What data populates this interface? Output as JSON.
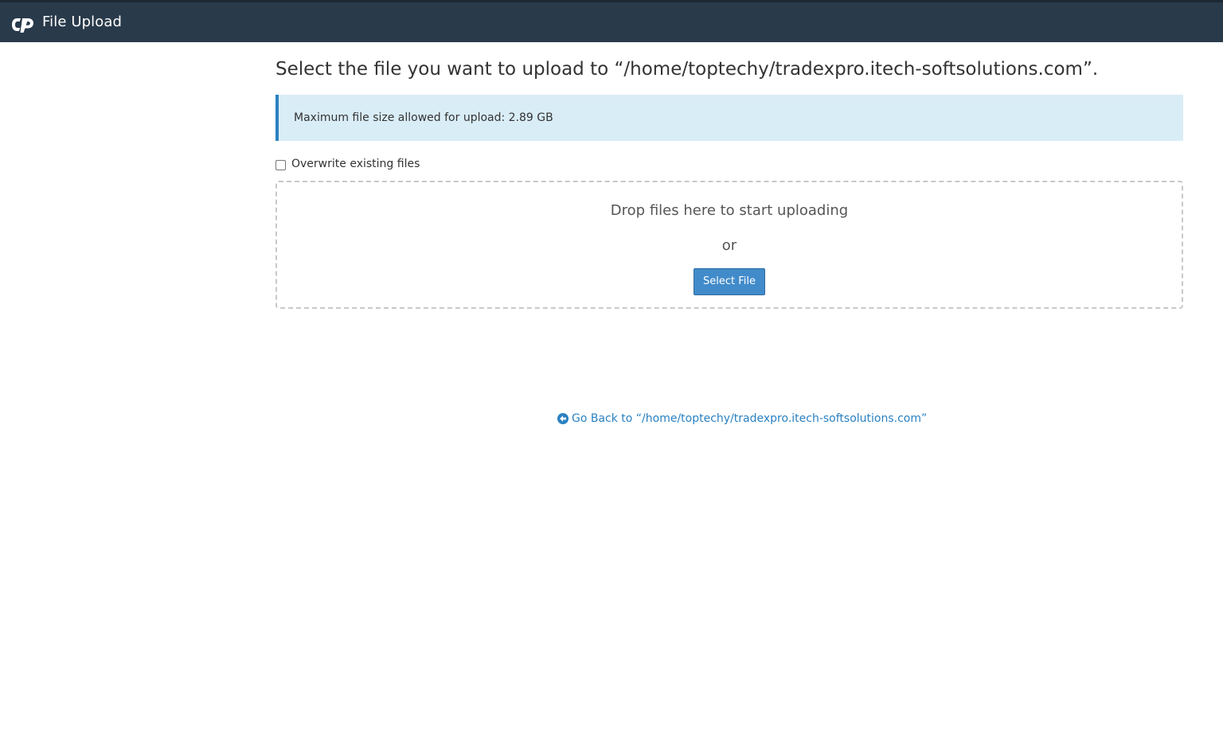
{
  "header": {
    "logo_icon": "cpanel-logo-icon",
    "title": "File Upload",
    "background_color": "#293a4a"
  },
  "main": {
    "heading": "Select the file you want to upload to “/home/toptechy/tradexpro.itech-softsolutions.com”.",
    "info_message": "Maximum file size allowed for upload: 2.89 GB",
    "overwrite_label": "Overwrite existing files",
    "overwrite_checked": false,
    "dropzone": {
      "drop_text": "Drop files here to start uploading",
      "or_text": "or",
      "select_button_label": "Select File"
    },
    "go_back": {
      "icon": "circle-arrow-left-icon",
      "label": "Go Back to “/home/toptechy/tradexpro.itech-softsolutions.com”"
    }
  },
  "colors": {
    "accent": "#428bca",
    "link": "#2a81c1",
    "info_background": "#d9edf7"
  }
}
